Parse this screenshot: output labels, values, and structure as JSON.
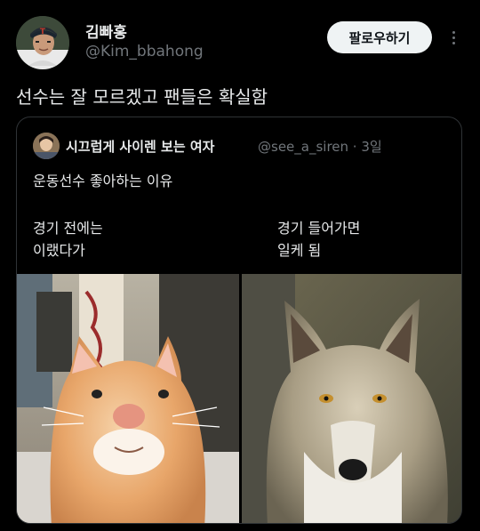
{
  "author": {
    "display_name": "김빠홍",
    "handle": "@Kim_bbahong"
  },
  "follow_button_label": "팔로우하기",
  "tweet_text": "선수는 잘 모르겠고 팬들은 확실함",
  "quoted": {
    "display_name": "시끄럽게 사이렌 보는 여자",
    "handle": "@see_a_siren · 3일",
    "line1": "운동선수 좋아하는 이유",
    "left_text_1": "경기 전에는",
    "left_text_2": "이랬다가",
    "right_text_1": "경기 들어가면",
    "right_text_2": "일케 됨",
    "images": [
      "cat-photo",
      "wolf-photo"
    ]
  },
  "colors": {
    "background": "#000000",
    "text_primary": "#e7e9ea",
    "text_secondary": "#71767b",
    "border": "#2f3336",
    "button_bg": "#eff3f4"
  }
}
